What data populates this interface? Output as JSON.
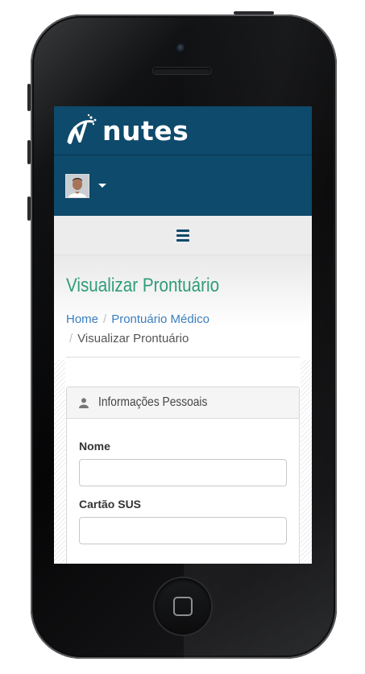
{
  "app": {
    "logo_text": "nutes",
    "brand_color": "#0e4a6b",
    "accent_color": "#2f9c7a"
  },
  "user": {
    "avatar_icon": "user-avatar"
  },
  "menu": {
    "icon": "hamburger-menu-icon"
  },
  "page": {
    "title": "Visualizar Prontuário",
    "breadcrumb": [
      {
        "label": "Home",
        "link": true
      },
      {
        "label": "Prontuário Médico",
        "link": true
      },
      {
        "label": "Visualizar Prontuário",
        "link": false
      }
    ]
  },
  "panel": {
    "icon": "user-icon",
    "title": "Informações Pessoais",
    "fields": [
      {
        "label": "Nome",
        "value": "",
        "placeholder": ""
      },
      {
        "label": "Cartão SUS",
        "value": "",
        "placeholder": ""
      }
    ]
  }
}
